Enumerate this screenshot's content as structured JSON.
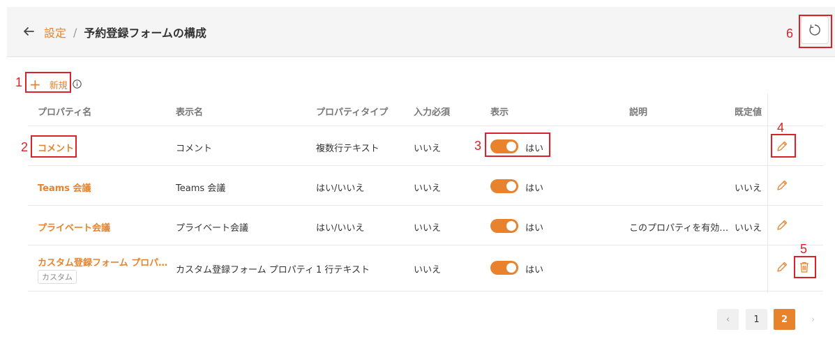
{
  "breadcrumb": {
    "parent": "設定",
    "separator": "/",
    "current": "予約登録フォームの構成"
  },
  "toolbar": {
    "new_label": "新規",
    "plus": "+"
  },
  "columns": [
    "プロパティ名",
    "表示名",
    "プロパティタイプ",
    "入力必須",
    "表示",
    "説明",
    "既定値"
  ],
  "rows": [
    {
      "name": "コメント",
      "display": "コメント",
      "type": "複数行テキスト",
      "required": "いいえ",
      "visible": "はい",
      "description": "",
      "default": "",
      "tag": "",
      "actions": [
        "edit"
      ]
    },
    {
      "name": "Teams 会議",
      "display": "Teams 会議",
      "type": "はい/いいえ",
      "required": "いいえ",
      "visible": "はい",
      "description": "",
      "default": "いいえ",
      "tag": "",
      "actions": [
        "edit"
      ]
    },
    {
      "name": "プライベート会議",
      "display": "プライベート会議",
      "type": "はい/いいえ",
      "required": "いいえ",
      "visible": "はい",
      "description": "このプロパティを有効…",
      "default": "いいえ",
      "tag": "",
      "actions": [
        "edit"
      ]
    },
    {
      "name": "カスタム登録フォーム プロパ…",
      "display": "カスタム登録フォーム プロパティ",
      "type": "1 行テキスト",
      "required": "いいえ",
      "visible": "はい",
      "description": "",
      "default": "",
      "tag": "カスタム",
      "actions": [
        "edit",
        "delete"
      ]
    }
  ],
  "pagination": {
    "prev": "‹",
    "pages": [
      "1",
      "2"
    ],
    "current": "2",
    "next": "›"
  },
  "callouts": [
    "1",
    "2",
    "3",
    "4",
    "5",
    "6"
  ],
  "colors": {
    "accent": "#e8822c",
    "callout": "#d8232a"
  }
}
